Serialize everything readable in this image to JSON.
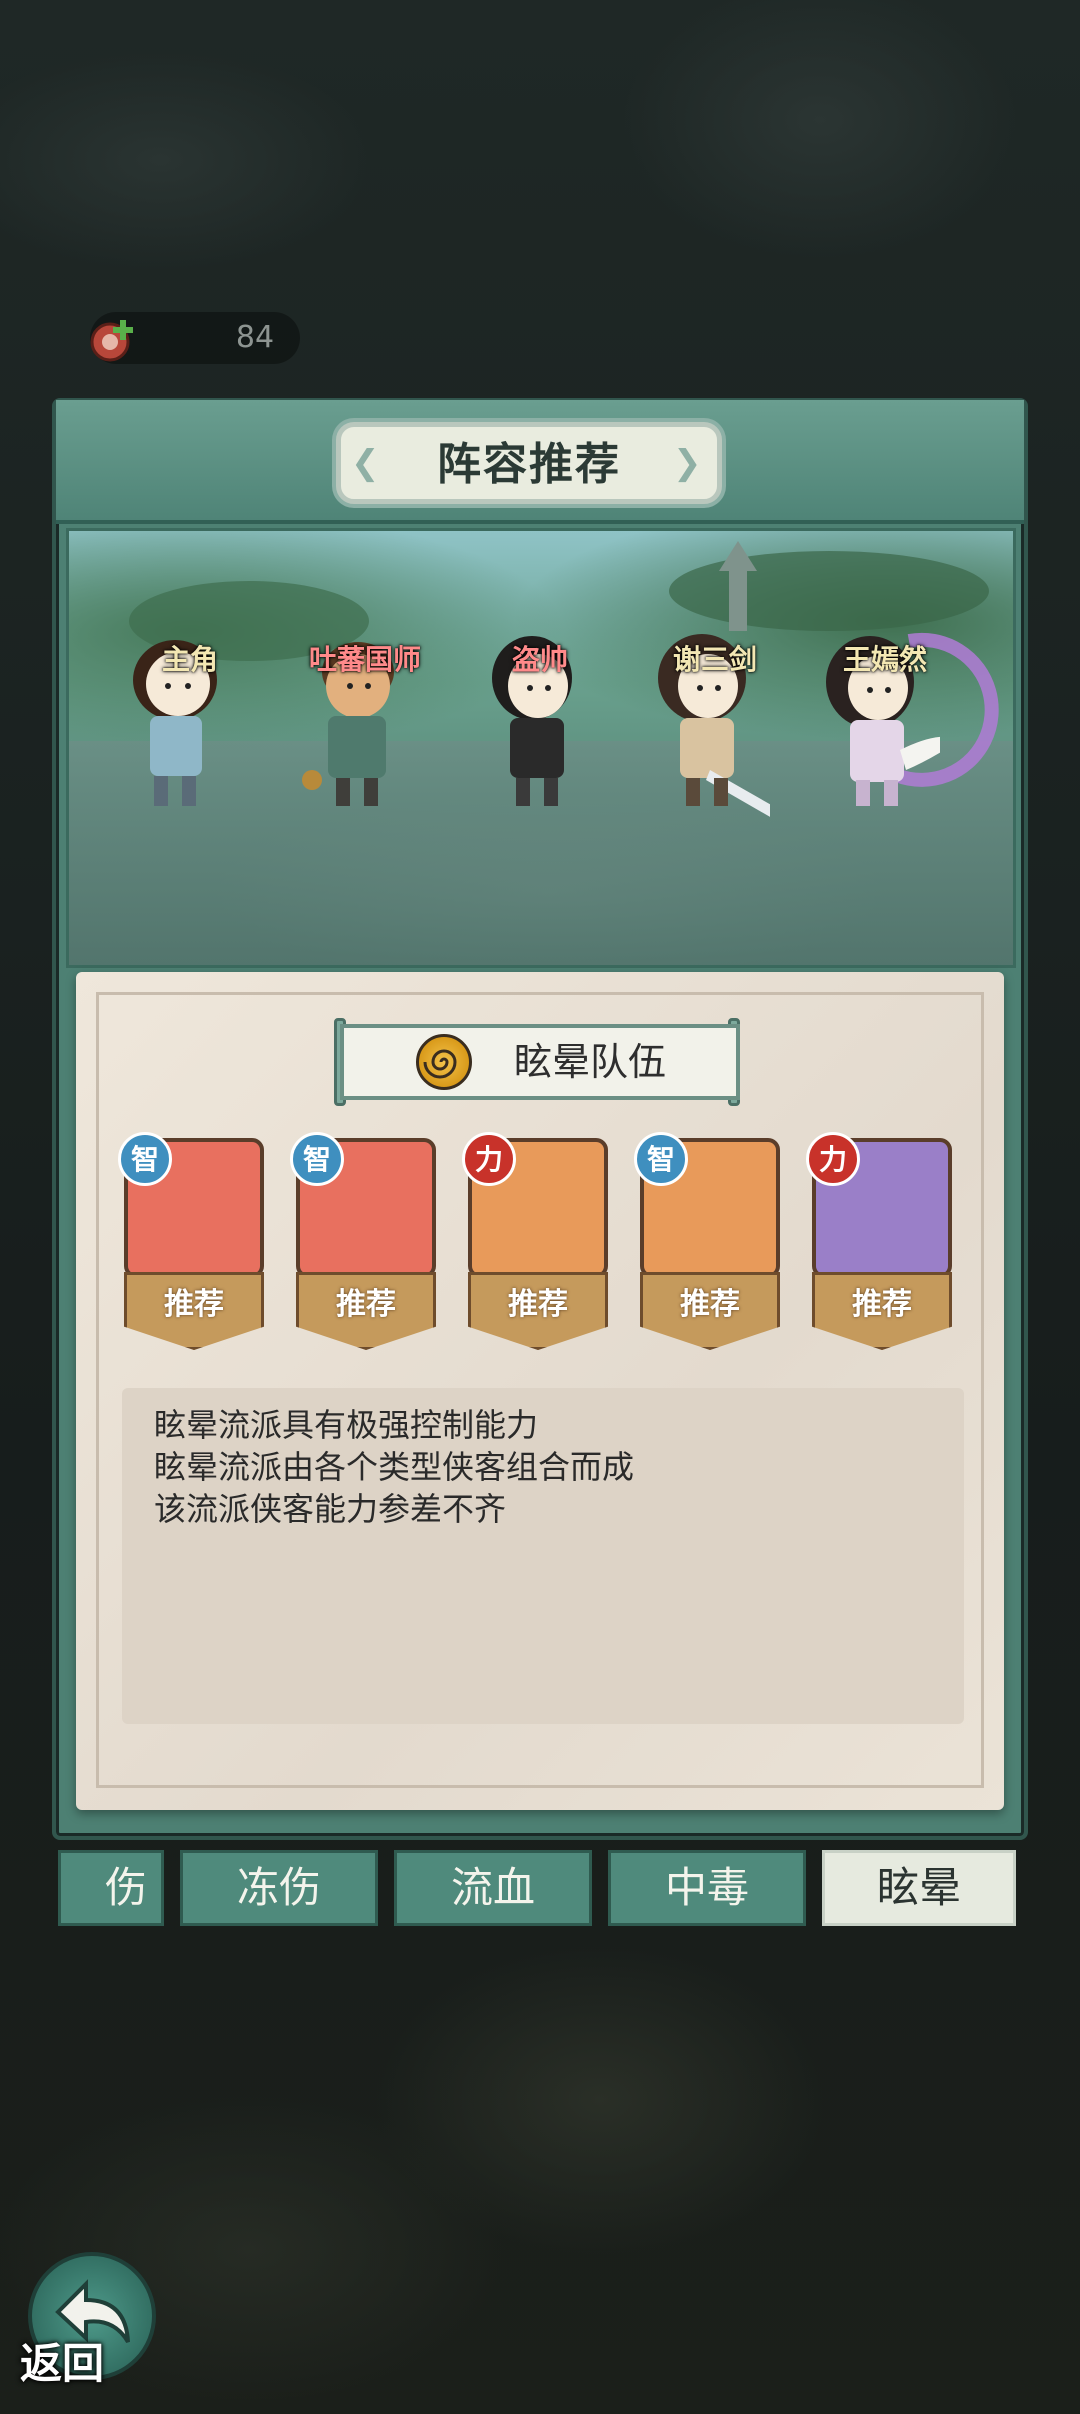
{
  "resource": {
    "icon": "meat-plus-icon",
    "value": "84"
  },
  "panel": {
    "title": "阵容推荐"
  },
  "lineup": [
    {
      "name": "主角",
      "name_color": "#f3e7b3"
    },
    {
      "name": "吐蕃国师",
      "name_color": "#ff8a8a"
    },
    {
      "name": "盗帅",
      "name_color": "#ff8a8a"
    },
    {
      "name": "谢三剑",
      "name_color": "#f3e7b3"
    },
    {
      "name": "王嫣然",
      "name_color": "#f3e7b3"
    }
  ],
  "team": {
    "icon": "swirl-stun-icon",
    "name": "眩晕队伍",
    "members": [
      {
        "badge": "智",
        "badge_color": "#3f8fbf",
        "portrait_bg": "#e8705f",
        "recommend": "推荐"
      },
      {
        "badge": "智",
        "badge_color": "#3f8fbf",
        "portrait_bg": "#e8705f",
        "recommend": "推荐"
      },
      {
        "badge": "力",
        "badge_color": "#c8322a",
        "portrait_bg": "#e89a5a",
        "recommend": "推荐"
      },
      {
        "badge": "智",
        "badge_color": "#3f8fbf",
        "portrait_bg": "#e89a5a",
        "recommend": "推荐"
      },
      {
        "badge": "力",
        "badge_color": "#c8322a",
        "portrait_bg": "#9a7fc8",
        "recommend": "推荐"
      }
    ],
    "description": [
      "眩晕流派具有极强控制能力",
      "眩晕流派由各个类型侠客组合而成",
      "该流派侠客能力参差不齐"
    ]
  },
  "tabs": [
    {
      "label": "伤",
      "active": false
    },
    {
      "label": "冻伤",
      "active": false
    },
    {
      "label": "流血",
      "active": false
    },
    {
      "label": "中毒",
      "active": false
    },
    {
      "label": "眩晕",
      "active": true
    }
  ],
  "back": {
    "label": "返回",
    "icon": "back-arrow-icon"
  }
}
